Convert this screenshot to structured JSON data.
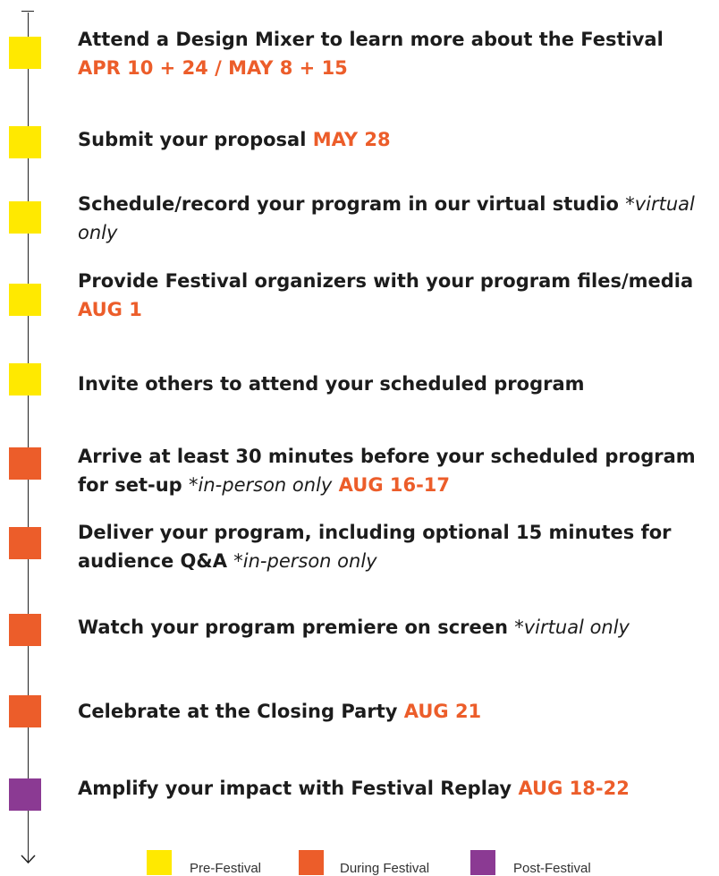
{
  "colors": {
    "pre_festival": "#ffe900",
    "during_festival": "#ec5d2a",
    "post_festival": "#8b3a93",
    "date_text": "#ec5d2a",
    "line": "#222222"
  },
  "steps": [
    {
      "phase": "pre_festival",
      "text": "Attend a Design Mixer to learn more about the Festival",
      "note": "",
      "date": "APR 10 + 24 / MAY 8 + 15"
    },
    {
      "phase": "pre_festival",
      "text": "Submit your proposal",
      "note": "",
      "date": "MAY 28"
    },
    {
      "phase": "pre_festival",
      "text": "Schedule/record your program in our virtual studio",
      "note": "*virtual only",
      "date": ""
    },
    {
      "phase": "pre_festival",
      "text": "Provide Festival organizers with your program files/media",
      "note": "",
      "date": "AUG 1"
    },
    {
      "phase": "pre_festival",
      "text": "Invite others to attend your scheduled program",
      "note": "",
      "date": ""
    },
    {
      "phase": "during_festival",
      "text": "Arrive at least 30 minutes before your scheduled program for set-up",
      "note": "*in-person only",
      "date": "AUG 16-17"
    },
    {
      "phase": "during_festival",
      "text": "Deliver your program, including optional 15 minutes for audience Q&A",
      "note": "*in-person only",
      "date": ""
    },
    {
      "phase": "during_festival",
      "text": "Watch your program premiere on screen",
      "note": "*virtual only",
      "date": ""
    },
    {
      "phase": "during_festival",
      "text": "Celebrate at the Closing Party",
      "note": "",
      "date": "AUG 21"
    },
    {
      "phase": "post_festival",
      "text": "Amplify your impact with Festival Replay",
      "note": "",
      "date": "AUG 18-22"
    }
  ],
  "legend": [
    {
      "phase": "pre_festival",
      "label": "Pre-Festival"
    },
    {
      "phase": "during_festival",
      "label": "During Festival"
    },
    {
      "phase": "post_festival",
      "label": "Post-Festival"
    }
  ]
}
